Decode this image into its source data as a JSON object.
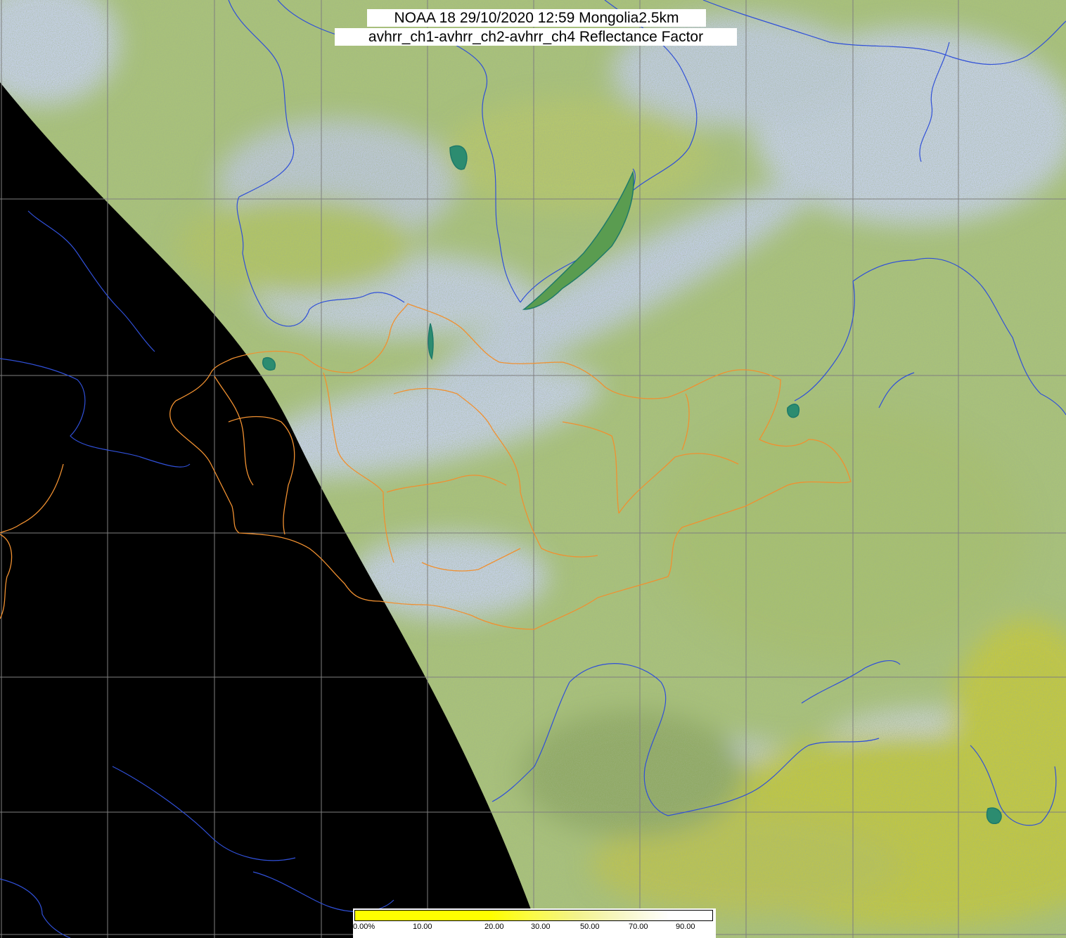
{
  "header": {
    "line1": "NOAA 18 29/10/2020 12:59 Mongolia2.5km",
    "line2": "avhrr_ch1-avhrr_ch2-avhrr_ch4 Reflectance Factor"
  },
  "colorbar": {
    "labels": [
      "0.00%",
      "10.00",
      "20.00",
      "30.00",
      "50.00",
      "70.00",
      "90.00"
    ],
    "range": [
      0,
      100
    ]
  },
  "colors": {
    "no_data": "#000000",
    "land_base": "#a9c27a",
    "cloud": "#c8d2f0",
    "bright_land": "#c6c93a",
    "grid": "#7f7f7f",
    "rivers_coast": "#3050d8",
    "borders": "#f09030",
    "lakes": "#1e7a6a"
  }
}
